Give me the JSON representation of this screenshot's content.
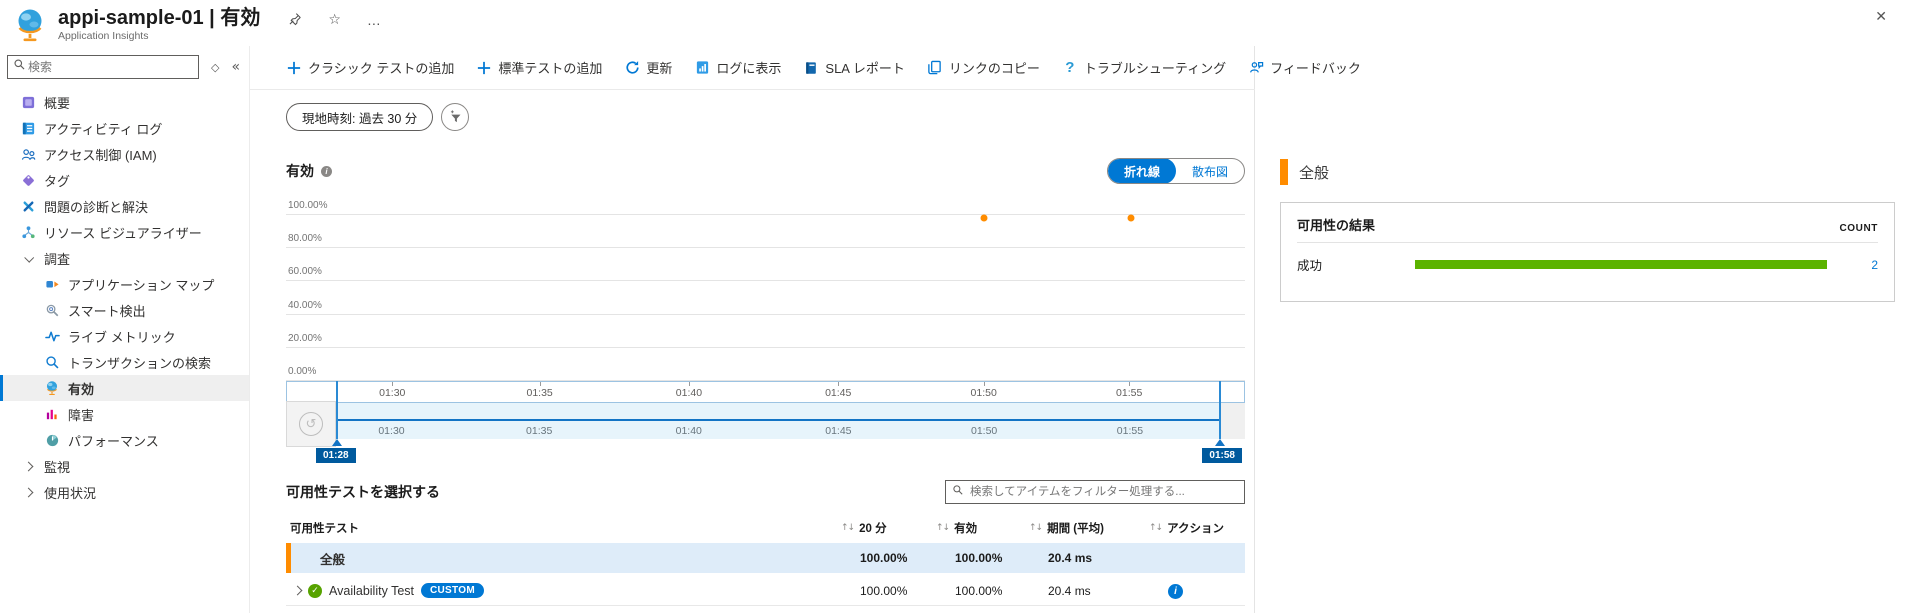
{
  "app": {
    "title": "appi-sample-01 | 有効",
    "subtitle": "Application Insights",
    "close_glyph": "✕",
    "star_glyph": "☆",
    "more_glyph": "…"
  },
  "sidebar": {
    "search_placeholder": "検索",
    "collapse_glyph": "«",
    "diamond_glyph": "◇",
    "items": [
      {
        "label": "概要"
      },
      {
        "label": "アクティビティ ログ"
      },
      {
        "label": "アクセス制御 (IAM)"
      },
      {
        "label": "タグ"
      },
      {
        "label": "問題の診断と解決"
      },
      {
        "label": "リソース ビジュアライザー"
      },
      {
        "label": "調査"
      },
      {
        "label": "アプリケーション マップ"
      },
      {
        "label": "スマート検出"
      },
      {
        "label": "ライブ メトリック"
      },
      {
        "label": "トランザクションの検索"
      },
      {
        "label": "有効"
      },
      {
        "label": "障害"
      },
      {
        "label": "パフォーマンス"
      },
      {
        "label": "監視"
      },
      {
        "label": "使用状況"
      }
    ]
  },
  "toolbar": {
    "items": [
      {
        "label": "クラシック テストの追加"
      },
      {
        "label": "標準テストの追加"
      },
      {
        "label": "更新"
      },
      {
        "label": "ログに表示"
      },
      {
        "label": "SLA レポート"
      },
      {
        "label": "リンクのコピー"
      },
      {
        "label": "トラブルシューティング"
      },
      {
        "label": "フィードバック"
      }
    ]
  },
  "filters": {
    "time_range_pill": "現地時刻: 過去 30 分"
  },
  "availability": {
    "title": "有効",
    "toggle": {
      "line": "折れ線",
      "scatter": "散布図",
      "selected": "折れ線"
    }
  },
  "chart_data": [
    {
      "type": "scatter",
      "title": "有効",
      "x": [
        "01:50",
        "01:55"
      ],
      "values": [
        100,
        100
      ],
      "ylim": [
        0,
        100
      ],
      "y_ticks": [
        "100.00%",
        "80.00%",
        "60.00%",
        "40.00%",
        "20.00%",
        "0.00%"
      ],
      "x_axis_ticks": [
        "01:30",
        "01:35",
        "01:40",
        "01:45",
        "01:50",
        "01:55"
      ],
      "time_window": {
        "start": "01:28",
        "end": "01:58"
      },
      "point_color": "#ff8c00",
      "grid": true,
      "legend": "none"
    },
    {
      "type": "bar",
      "title": "可用性の結果",
      "categories": [
        "成功"
      ],
      "values": [
        2
      ],
      "count_header": "COUNT",
      "bar_color": "#5bb300",
      "orientation": "horizontal"
    }
  ],
  "tests": {
    "title": "可用性テストを選択する",
    "filter_placeholder": "検索してアイテムをフィルター処理する...",
    "sort_glyph": "↑↓",
    "columns": [
      "可用性テスト",
      "20 分",
      "有効",
      "期間 (平均)",
      "アクション"
    ],
    "rows": [
      {
        "name": "全般",
        "pct_20min": "100.00%",
        "availability": "100.00%",
        "duration_avg": "20.4 ms"
      },
      {
        "name": "Availability Test",
        "badge": "CUSTOM",
        "pct_20min": "100.00%",
        "availability": "100.00%",
        "duration_avg": "20.4 ms",
        "check_glyph": "✓",
        "info_glyph": "i"
      }
    ]
  },
  "detail_panel": {
    "title": "全般",
    "card": {
      "title": "可用性の結果",
      "count_header": "COUNT",
      "rows": [
        {
          "label": "成功",
          "count": "2"
        }
      ]
    }
  },
  "colors": {
    "accent_blue": "#0078d4",
    "orange": "#ff8c00",
    "green": "#5bb300",
    "selected_row_bg": "#deecf9"
  }
}
